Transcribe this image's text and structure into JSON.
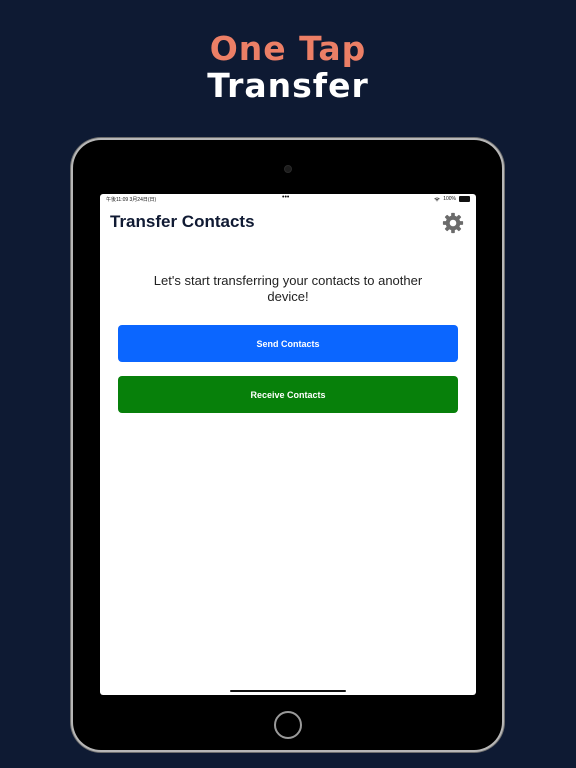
{
  "promo": {
    "line1": "One Tap",
    "line2": "Transfer"
  },
  "status_bar": {
    "time": "午後11:09 3月24日(日)",
    "dots": "•••",
    "battery": "100%"
  },
  "nav": {
    "title": "Transfer Contacts",
    "settings_icon": "gear-icon"
  },
  "main": {
    "intro": "Let's start transferring your contacts to another device!",
    "send_label": "Send Contacts",
    "receive_label": "Receive Contacts"
  },
  "colors": {
    "background": "#0e1a33",
    "accent_headline": "#ec7f66",
    "send_button": "#0b66ff",
    "receive_button": "#07800a"
  }
}
